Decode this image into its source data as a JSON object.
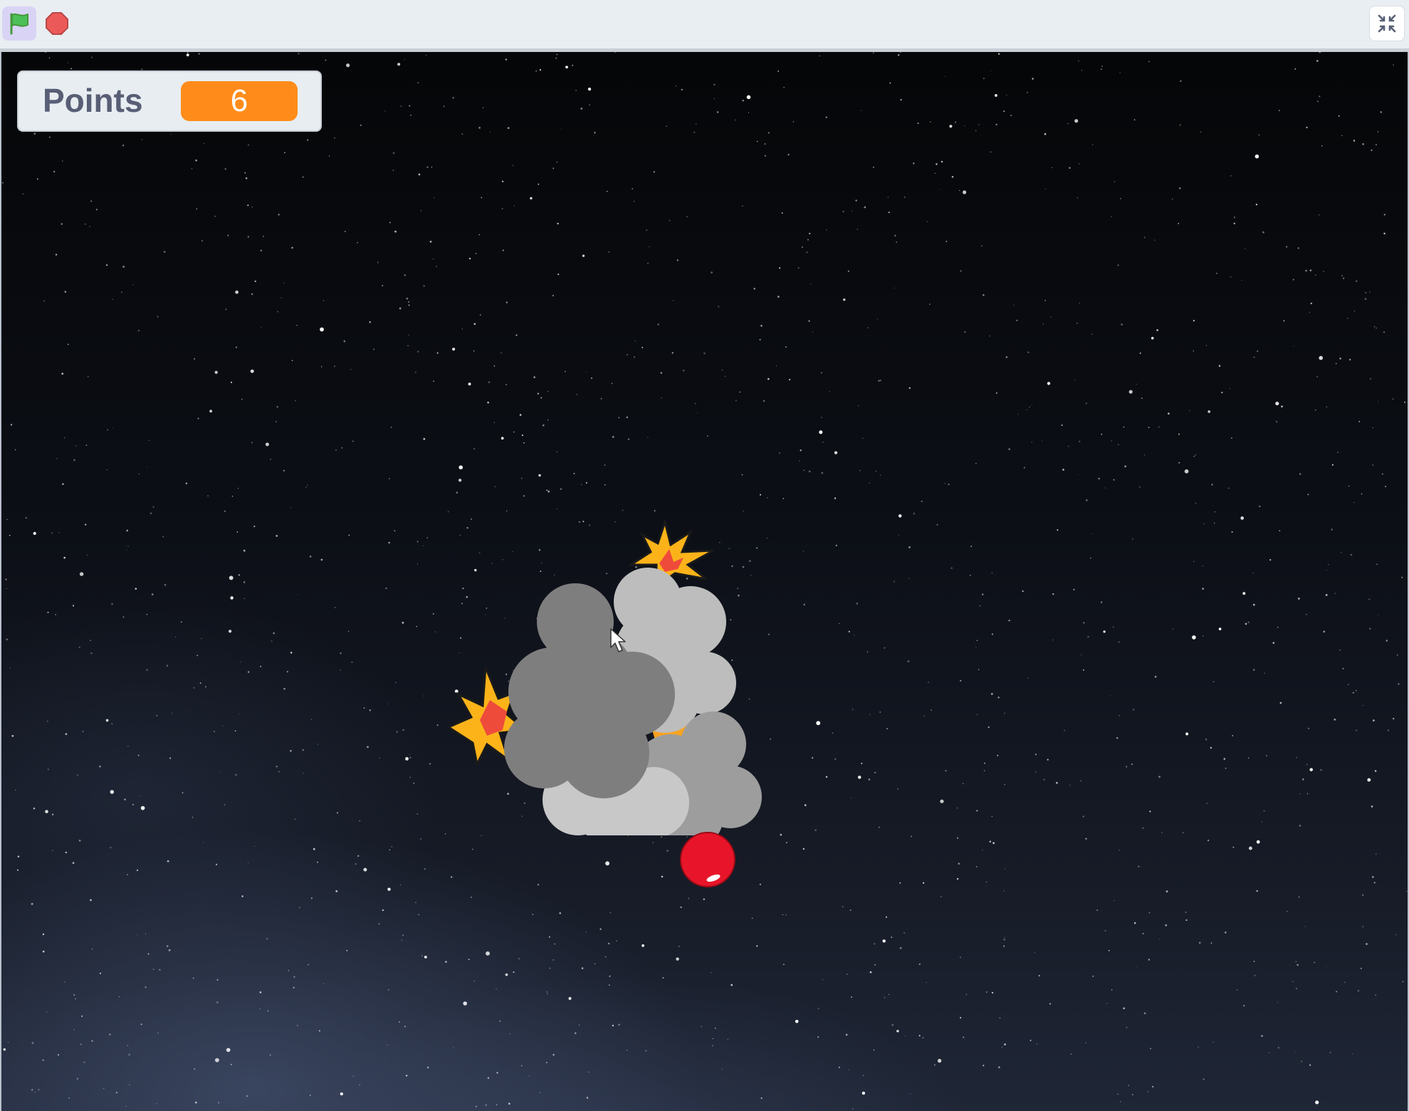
{
  "toolbar": {
    "green_flag_icon": "green-flag-icon",
    "stop_icon": "stop-sign-icon",
    "fullscreen_icon": "exit-fullscreen-icon"
  },
  "monitor": {
    "label": "Points",
    "value": "6"
  },
  "sprites": {
    "explosion": "explosion-cloud",
    "apple": "red-apple"
  },
  "colors": {
    "monitor_value_bg": "#ff8c1a",
    "monitor_label": "#575e75",
    "flag_green": "#4cbf56",
    "stop_red": "#ec5959"
  }
}
